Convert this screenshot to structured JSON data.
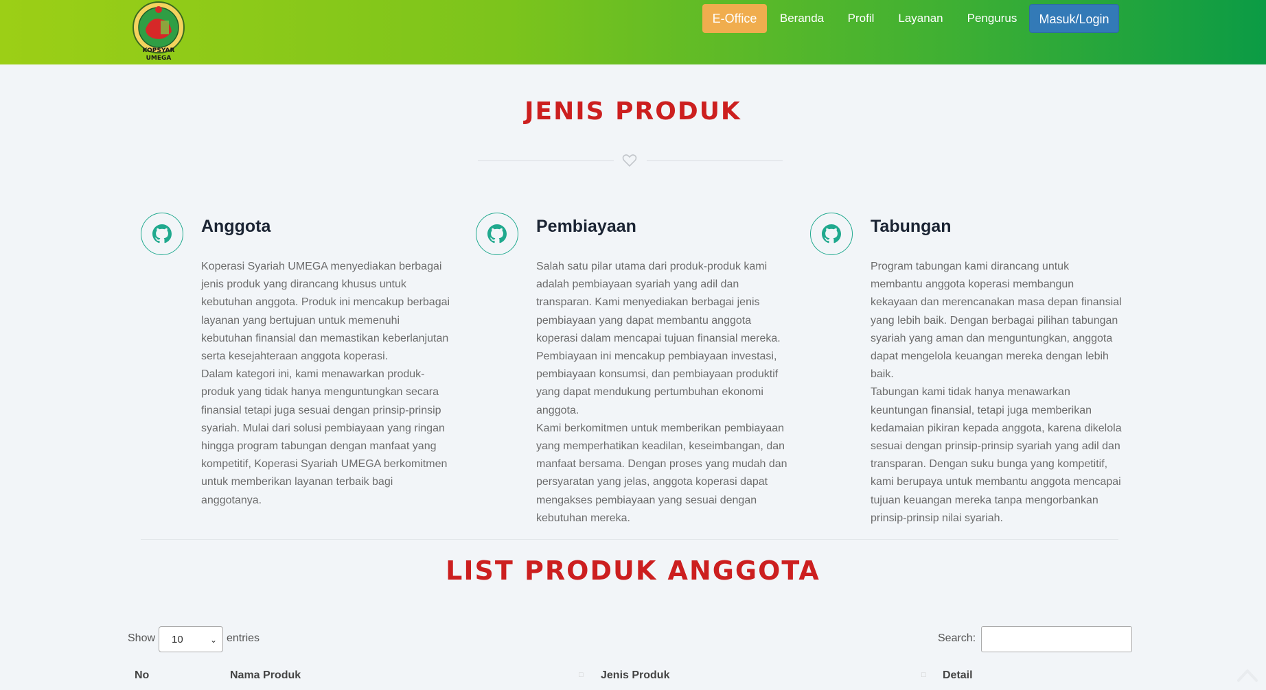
{
  "header": {
    "logo_text": "KOPSYAR UMEGA",
    "nav": {
      "eoffice": "E-Office",
      "beranda": "Beranda",
      "profil": "Profil",
      "layanan": "Layanan",
      "pengurus": "Pengurus",
      "login": "Masuk/Login"
    }
  },
  "section1": {
    "title": "JENIS PRODUK"
  },
  "features": [
    {
      "title": "Anggota",
      "icon": "github-icon",
      "paragraphs": [
        "Koperasi Syariah UMEGA menyediakan berbagai jenis produk yang dirancang khusus untuk kebutuhan anggota. Produk ini mencakup berbagai layanan yang bertujuan untuk memenuhi kebutuhan finansial dan memastikan keberlanjutan serta kesejahteraan anggota koperasi.",
        "Dalam kategori ini, kami menawarkan produk-produk yang tidak hanya menguntungkan secara finansial tetapi juga sesuai dengan prinsip-prinsip syariah. Mulai dari solusi pembiayaan yang ringan hingga program tabungan dengan manfaat yang kompetitif, Koperasi Syariah UMEGA berkomitmen untuk memberikan layanan terbaik bagi anggotanya."
      ]
    },
    {
      "title": "Pembiayaan",
      "icon": "github-icon",
      "paragraphs": [
        "Salah satu pilar utama dari produk-produk kami adalah pembiayaan syariah yang adil dan transparan. Kami menyediakan berbagai jenis pembiayaan yang dapat membantu anggota koperasi dalam mencapai tujuan finansial mereka. Pembiayaan ini mencakup pembiayaan investasi, pembiayaan konsumsi, dan pembiayaan produktif yang dapat mendukung pertumbuhan ekonomi anggota.",
        "Kami berkomitmen untuk memberikan pembiayaan yang memperhatikan keadilan, keseimbangan, dan manfaat bersama. Dengan proses yang mudah dan persyaratan yang jelas, anggota koperasi dapat mengakses pembiayaan yang sesuai dengan kebutuhan mereka."
      ]
    },
    {
      "title": "Tabungan",
      "icon": "github-icon",
      "paragraphs": [
        "Program tabungan kami dirancang untuk membantu anggota koperasi membangun kekayaan dan merencanakan masa depan finansial yang lebih baik. Dengan berbagai pilihan tabungan syariah yang aman dan menguntungkan, anggota dapat mengelola keuangan mereka dengan lebih baik.",
        "Tabungan kami tidak hanya menawarkan keuntungan finansial, tetapi juga memberikan kedamaian pikiran kepada anggota, karena dikelola sesuai dengan prinsip-prinsip syariah yang adil dan transparan. Dengan suku bunga yang kompetitif, kami berupaya untuk membantu anggota mencapai tujuan keuangan mereka tanpa mengorbankan prinsip-prinsip nilai syariah."
      ]
    }
  ],
  "section2": {
    "title": "LIST PRODUK ANGGOTA"
  },
  "table": {
    "show_label": "Show",
    "entries_label": "entries",
    "length_value": "10",
    "search_label": "Search:",
    "search_value": "",
    "columns": [
      "No",
      "Nama Produk",
      "Jenis Produk",
      "Detail"
    ]
  }
}
